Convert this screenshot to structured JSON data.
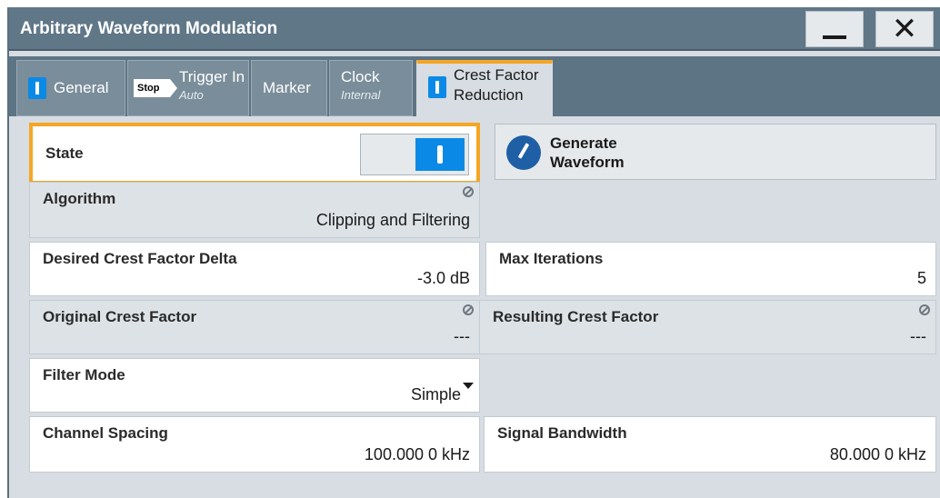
{
  "window": {
    "title": "Arbitrary Waveform Modulation",
    "minimize_icon": "minimize-icon",
    "close_glyph": "✕"
  },
  "tabs": [
    {
      "label": "General",
      "sub": "",
      "indicator": true
    },
    {
      "label": "Trigger In",
      "sub": "Auto",
      "badge": "Stop"
    },
    {
      "label": "Marker",
      "sub": ""
    },
    {
      "label": "Clock",
      "sub": "Internal"
    },
    {
      "label": "Crest Factor\nReduction",
      "sub": "",
      "indicator": true,
      "active": true
    }
  ],
  "state": {
    "label": "State",
    "on": true
  },
  "generate": {
    "label": "Generate\nWaveform",
    "icon": "waveform-edit-icon"
  },
  "fields": {
    "algorithm": {
      "label": "Algorithm",
      "value": "Clipping and Filtering"
    },
    "desired_delta": {
      "label": "Desired Crest Factor Delta",
      "value": "-3.0 dB"
    },
    "max_iterations": {
      "label": "Max Iterations",
      "value": "5"
    },
    "original_cf": {
      "label": "Original Crest Factor",
      "value": "---"
    },
    "resulting_cf": {
      "label": "Resulting Crest Factor",
      "value": "---"
    },
    "filter_mode": {
      "label": "Filter Mode",
      "value": "Simple"
    },
    "channel_spacing": {
      "label": "Channel Spacing",
      "value": "100.000 0 kHz"
    },
    "signal_bandwidth": {
      "label": "Signal Bandwidth",
      "value": "80.000 0 kHz"
    }
  },
  "colors": {
    "accent_orange": "#f5a623",
    "accent_blue": "#0a8ae6",
    "titlebar": "#607788"
  }
}
